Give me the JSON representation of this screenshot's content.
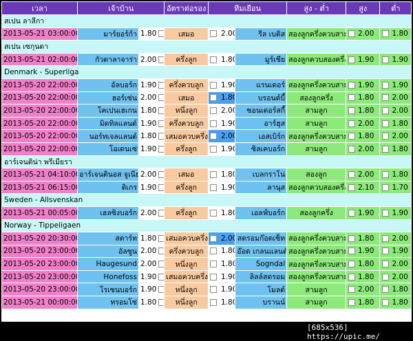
{
  "headers": [
    "เวลา",
    "เจ้าบ้าน",
    "อัตราต่อรอง",
    "ทีมเยือน",
    "สูง - ต่ำ",
    "สูง",
    "ต่ำ"
  ],
  "groups": [
    {
      "league": "สเปน ลาลีกา",
      "rows": [
        {
          "time": "2013-05-21 03:00:00",
          "home": "มาร์ยอร์ก้า",
          "home_odds": "1.80",
          "handicap": "เสมอ",
          "away_odds": "2.00",
          "away": "รีล เบติส",
          "ou_line": "สองลูกครึ่งควบสาม",
          "over": "2.00",
          "under": "1.80",
          "away_hl": false
        }
      ]
    },
    {
      "league": "สเปน เซกุนดา",
      "rows": [
        {
          "time": "2013-05-21 02:00:00",
          "home": "กัวดาลาจาร่า",
          "home_odds": "2.00",
          "handicap": "ครึ่งลูก",
          "away_odds": "1.80",
          "away": "มูร์เซีย",
          "ou_line": "สองลูกควบสองครึ่ง",
          "over": "1.90",
          "under": "1.90",
          "away_hl": false
        }
      ]
    },
    {
      "league": "Denmark - Superliga",
      "rows": [
        {
          "time": "2013-05-20 22:00:00",
          "home": "อัลบอร์ก",
          "home_odds": "1.90",
          "handicap": "ครึ่งควบลูก",
          "away_odds": "1.90",
          "away": "แรนเดอร์",
          "ou_line": "สองลูกครึ่งควบสาม",
          "over": "1.90",
          "under": "1.90",
          "away_hl": false
        },
        {
          "time": "2013-05-20 22:00:00",
          "home": "ฮอร์เซ่น",
          "home_odds": "2.00",
          "handicap": "เสมอ",
          "away_odds": "1.80",
          "away": "บรอนด์บี้",
          "ou_line": "สองลูกครึ่ง",
          "over": "1.80",
          "under": "2.00",
          "away_hl": true
        },
        {
          "time": "2013-05-20 22:00:00",
          "home": "โคเปนเฮเกน",
          "home_odds": "1.80",
          "handicap": "หนึ่งลูก",
          "away_odds": "2.00",
          "away": "ซอนเดอร์สกี้",
          "ou_line": "สามลูก",
          "over": "1.80",
          "under": "2.00",
          "away_hl": false
        },
        {
          "time": "2013-05-20 22:00:00",
          "home": "มิดทิลแลนด์",
          "home_odds": "1.90",
          "handicap": "ครึ่งควบลูก",
          "away_odds": "1.90",
          "away": "อาร์ฮุส",
          "ou_line": "สามลูก",
          "over": "2.00",
          "under": "1.80",
          "away_hl": false
        },
        {
          "time": "2013-05-20 22:00:00",
          "home": "นอร์ทเจลแลนด์",
          "home_odds": "1.80",
          "handicap": "เสมอควบครึ่ง",
          "away_odds": "2.00",
          "away": "เอสเบิร์ก",
          "ou_line": "สองลูกครึ่งควบสาม",
          "over": "1.80",
          "under": "2.00",
          "away_hl": true
        },
        {
          "time": "2013-05-20 22:00:00",
          "home": "โอเดนเซ่",
          "home_odds": "1.90",
          "handicap": "ครึ่งลูก",
          "away_odds": "1.90",
          "away": "ซิลเคบอร์ก",
          "ou_line": "สามลูก",
          "over": "2.00",
          "under": "1.80",
          "away_hl": false
        }
      ]
    },
    {
      "league": "อาร์เจนติน่า พรีเมียรา",
      "rows": [
        {
          "time": "2013-05-21 04:10:00",
          "home": "อาร์เจนตินอส จูเนียร์",
          "home_odds": "2.00",
          "handicap": "เสมอ",
          "away_odds": "1.80",
          "away": "เบลกราโน่",
          "ou_line": "สองลูก",
          "over": "2.00",
          "under": "1.80",
          "away_hl": false
        },
        {
          "time": "2013-05-21 06:15:00",
          "home": "ติเกร",
          "home_odds": "1.90",
          "handicap": "ครึ่งลูก",
          "away_odds": "1.90",
          "away": "ลานุส",
          "ou_line": "สองลูกควบสองครึ่ง",
          "over": "2.10",
          "under": "1.70",
          "away_hl": false
        }
      ]
    },
    {
      "league": "Sweden - Allsvenskan",
      "rows": [
        {
          "time": "2013-05-21 00:05:00",
          "home": "เฮลซิงบอร์ก",
          "home_odds": "2.00",
          "handicap": "ครึ่งลูก",
          "away_odds": "1.80",
          "away": "เอลฟ์บอร์ก",
          "ou_line": "สองลูกครึ่ง",
          "over": "1.90",
          "under": "1.90",
          "away_hl": false
        }
      ]
    },
    {
      "league": "Norway - Tippeligaen",
      "rows": [
        {
          "time": "2013-05-20 20:30:00",
          "home": "สตาร์ท",
          "home_odds": "1.80",
          "handicap": "เสมอควบครึ่ง",
          "away_odds": "2.00",
          "away": "สตรอมก๊อดเซ็ท",
          "ou_line": "สองลูกครึ่งควบสาม",
          "over": "1.80",
          "under": "2.00",
          "away_hl": true
        },
        {
          "time": "2013-05-20 23:00:00",
          "home": "อัลซูน",
          "home_odds": "2.00",
          "handicap": "ครึ่งควบลูก",
          "away_odds": "1.80",
          "away": "อ๊อด เกลนแลนด์",
          "ou_line": "สองลูกครึ่งควบสาม",
          "over": "1.90",
          "under": "1.90",
          "away_hl": false
        },
        {
          "time": "2013-05-20 23:00:00",
          "home": "Haugesund",
          "home_odds": "2.00",
          "handicap": "หนึ่งลูก",
          "away_odds": "1.80",
          "away": "Sogndal",
          "ou_line": "สองลูกครึ่งควบสาม",
          "over": "1.80",
          "under": "2.00",
          "away_hl": false
        },
        {
          "time": "2013-05-20 23:00:00",
          "home": "Honefoss",
          "home_odds": "1.90",
          "handicap": "เสมอควบครึ่ง",
          "away_odds": "1.90",
          "away": "ลิลล์สตรอม",
          "ou_line": "สองลูกครึ่งควบสาม",
          "over": "1.80",
          "under": "2.00",
          "away_hl": false
        },
        {
          "time": "2013-05-20 23:00:00",
          "home": "โรเซนบอร์ก",
          "home_odds": "1.90",
          "handicap": "หนึ่งลูก",
          "away_odds": "1.90",
          "away": "โมลด์",
          "ou_line": "สามลูก",
          "over": "2.00",
          "under": "1.80",
          "away_hl": false
        },
        {
          "time": "2013-05-21 00:00:00",
          "home": "ทรอมโซ่",
          "home_odds": "1.80",
          "handicap": "หนึ่งลูก",
          "away_odds": "1.80",
          "away": "บรานน์",
          "ou_line": "สามลูก",
          "over": "1.80",
          "under": "1.80",
          "away_hl": false
        }
      ]
    }
  ],
  "footer": "[685x536] https://upic.me/"
}
